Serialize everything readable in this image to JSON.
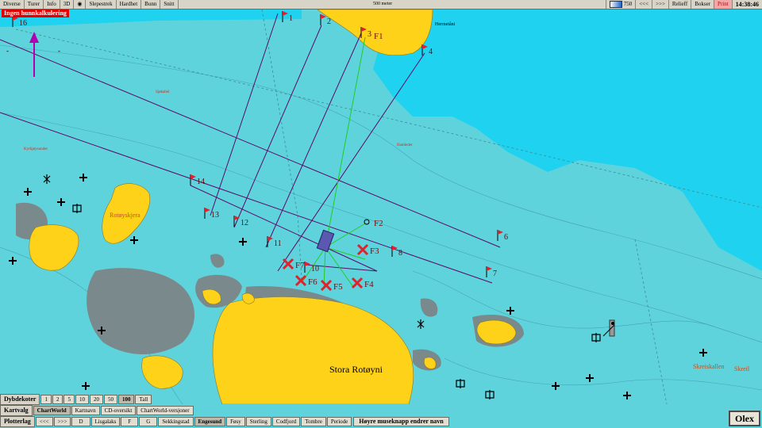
{
  "toolbar": {
    "menu_items": [
      "Diverse",
      "Turer",
      "Info",
      "3D",
      "Slepestrek",
      "Hardhet",
      "Bunn",
      "Snitt"
    ],
    "scale_label": "500 meter",
    "depth_value": "750",
    "nav_back": "<<<",
    "nav_forward": ">>>",
    "relief": "Relieff",
    "boxes": "Bokser",
    "print": "Print",
    "clock": "14:38:46"
  },
  "warning_banner": "Ingen hunnkalkulering",
  "map": {
    "colors": {
      "water_deep": "#1ed2f0",
      "water_shallow": "#5fd3dc",
      "land": "#ffd21a",
      "reef": "#7a8a8c",
      "route": "#5a0a6a",
      "green_route": "#22cc22",
      "mark": "#e0202a"
    },
    "place_names": [
      "Stora Rotøyni",
      "Rotøyskjera",
      "Skreiskallen",
      "Skreil",
      "Hermetåni",
      "Kyrkjøysundet",
      "Sjøkabel",
      "Hamleder"
    ],
    "flags": [
      "1",
      "2",
      "3",
      "4",
      "6",
      "7",
      "8",
      "10",
      "11",
      "12",
      "13",
      "14",
      "16"
    ],
    "fish_marks": [
      "F1",
      "F2",
      "F3",
      "F4",
      "F5",
      "F6",
      "F7"
    ],
    "icons": [
      "flag-icon",
      "cross-mark-icon",
      "rock-icon",
      "wreck-icon",
      "lighthouse-icon",
      "vessel-icon",
      "depth-arrow-icon"
    ]
  },
  "bottom": {
    "depth_row": {
      "label": "Dybdekoter",
      "options": [
        "1",
        "2",
        "5",
        "10",
        "20",
        "50",
        "100",
        "Tall"
      ],
      "selected": "100"
    },
    "chart_row": {
      "label": "Kartvalg",
      "options": [
        "ChartWorld",
        "Kartnavn",
        "CD-oversikt",
        "ChartWorld-versjoner"
      ],
      "selected": "ChartWorld"
    },
    "plot_row": {
      "label": "Plotterlag",
      "nav_back": "<<<",
      "nav_forward": ">>>",
      "options": [
        "D",
        "Lisgalaks",
        "F",
        "G",
        "Sekkingstad",
        "Engesund",
        "Føsy",
        "Sterling",
        "Codfjord",
        "Tombre",
        "Periode"
      ],
      "selected": "Engesund"
    },
    "hint": "Høyre museknapp endrer navn",
    "brand": "Olex"
  }
}
